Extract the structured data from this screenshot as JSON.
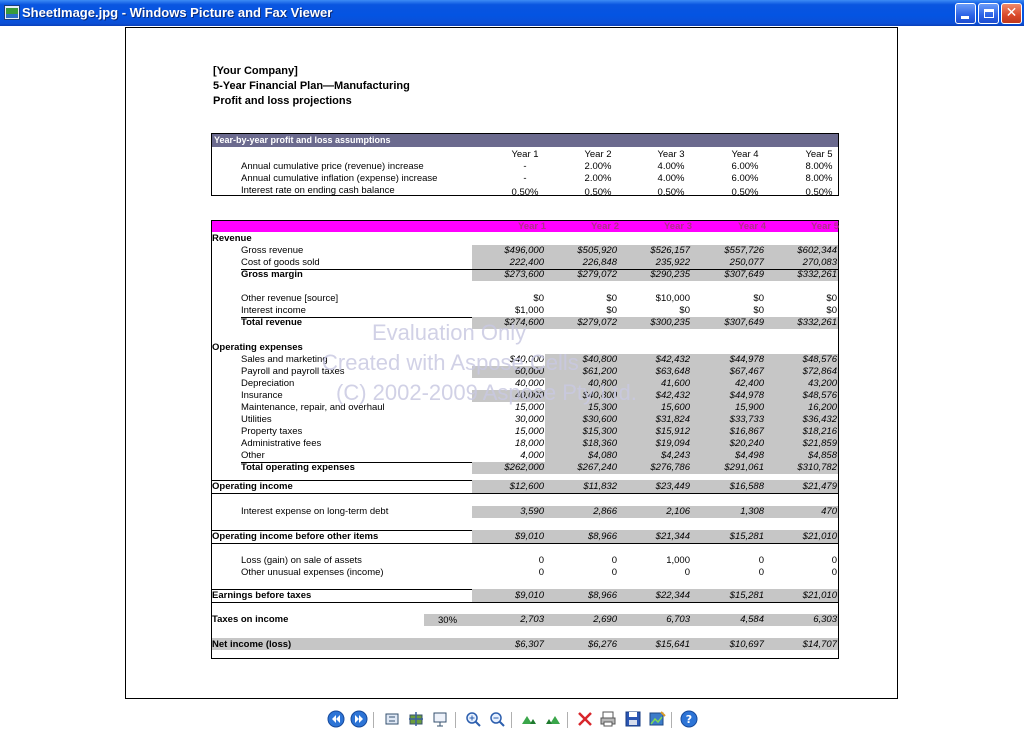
{
  "window": {
    "title": "SheetImage.jpg - Windows Picture and Fax Viewer"
  },
  "header": {
    "company": "[Your Company]",
    "plan": "5-Year Financial Plan—Manufacturing",
    "subtitle": "Profit and loss projections"
  },
  "assumptions": {
    "title": "Year-by-year profit and loss assumptions",
    "years": [
      "Year 1",
      "Year 2",
      "Year 3",
      "Year 4",
      "Year 5"
    ],
    "rows": [
      {
        "label": "Annual cumulative price (revenue) increase",
        "values": [
          "-",
          "2.00%",
          "4.00%",
          "6.00%",
          "8.00%"
        ]
      },
      {
        "label": "Annual cumulative inflation (expense) increase",
        "values": [
          "-",
          "2.00%",
          "4.00%",
          "6.00%",
          "8.00%"
        ]
      },
      {
        "label": "Interest rate on ending cash balance",
        "values": [
          "0.50%",
          "0.50%",
          "0.50%",
          "0.50%",
          "0.50%"
        ]
      }
    ]
  },
  "main": {
    "years": [
      "Year 1",
      "Year 2",
      "Year 3",
      "Year 4",
      "Year 5"
    ],
    "revenue": {
      "heading": "Revenue",
      "gross_revenue": {
        "label": "Gross revenue",
        "values": [
          "$496,000",
          "$505,920",
          "$526,157",
          "$557,726",
          "$602,344"
        ]
      },
      "cogs": {
        "label": "Cost of goods sold",
        "values": [
          "222,400",
          "226,848",
          "235,922",
          "250,077",
          "270,083"
        ]
      },
      "gross_margin": {
        "label": "Gross margin",
        "values": [
          "$273,600",
          "$279,072",
          "$290,235",
          "$307,649",
          "$332,261"
        ]
      },
      "other_revenue": {
        "label": "Other revenue [source]",
        "values": [
          "$0",
          "$0",
          "$10,000",
          "$0",
          "$0"
        ]
      },
      "interest_income": {
        "label": "Interest income",
        "values": [
          "$1,000",
          "$0",
          "$0",
          "$0",
          "$0"
        ]
      },
      "total_revenue": {
        "label": "Total revenue",
        "values": [
          "$274,600",
          "$279,072",
          "$300,235",
          "$307,649",
          "$332,261"
        ]
      }
    },
    "opex": {
      "heading": "Operating expenses",
      "rows": [
        {
          "label": "Sales and marketing",
          "values": [
            "$40,000",
            "$40,800",
            "$42,432",
            "$44,978",
            "$48,576"
          ]
        },
        {
          "label": "Payroll and payroll taxes",
          "values": [
            "60,000",
            "$61,200",
            "$63,648",
            "$67,467",
            "$72,864"
          ]
        },
        {
          "label": "Depreciation",
          "values": [
            "40,000",
            "40,800",
            "41,600",
            "42,400",
            "43,200"
          ]
        },
        {
          "label": "Insurance",
          "values": [
            "40,000",
            "$40,800",
            "$42,432",
            "$44,978",
            "$48,576"
          ]
        },
        {
          "label": "Maintenance, repair, and overhaul",
          "values": [
            "15,000",
            "15,300",
            "15,600",
            "15,900",
            "16,200"
          ]
        },
        {
          "label": "Utilities",
          "values": [
            "30,000",
            "$30,600",
            "$31,824",
            "$33,733",
            "$36,432"
          ]
        },
        {
          "label": "Property taxes",
          "values": [
            "15,000",
            "$15,300",
            "$15,912",
            "$16,867",
            "$18,216"
          ]
        },
        {
          "label": "Administrative fees",
          "values": [
            "18,000",
            "$18,360",
            "$19,094",
            "$20,240",
            "$21,859"
          ]
        },
        {
          "label": "Other",
          "values": [
            "4,000",
            "$4,080",
            "$4,243",
            "$4,498",
            "$4,858"
          ]
        }
      ],
      "total": {
        "label": "Total operating expenses",
        "values": [
          "$262,000",
          "$267,240",
          "$276,786",
          "$291,061",
          "$310,782"
        ]
      }
    },
    "operating_income": {
      "label": "Operating income",
      "values": [
        "$12,600",
        "$11,832",
        "$23,449",
        "$16,588",
        "$21,479"
      ]
    },
    "interest_expense": {
      "label": "Interest expense on long-term debt",
      "values": [
        "3,590",
        "2,866",
        "2,106",
        "1,308",
        "470"
      ]
    },
    "oi_before_other": {
      "label": "Operating income before other items",
      "values": [
        "$9,010",
        "$8,966",
        "$21,344",
        "$15,281",
        "$21,010"
      ]
    },
    "loss_gain": {
      "label": "Loss (gain) on sale of assets",
      "values": [
        "0",
        "0",
        "1,000",
        "0",
        "0"
      ]
    },
    "other_unusual": {
      "label": "Other unusual expenses (income)",
      "values": [
        "0",
        "0",
        "0",
        "0",
        "0"
      ]
    },
    "ebt": {
      "label": "Earnings before taxes",
      "values": [
        "$9,010",
        "$8,966",
        "$22,344",
        "$15,281",
        "$21,010"
      ]
    },
    "taxes": {
      "label": "Taxes on income",
      "rate": "30%",
      "values": [
        "2,703",
        "2,690",
        "6,703",
        "4,584",
        "6,303"
      ]
    },
    "net_income": {
      "label": "Net income (loss)",
      "values": [
        "$6,307",
        "$6,276",
        "$15,641",
        "$10,697",
        "$14,707"
      ]
    }
  },
  "watermark": {
    "line1": "Evaluation Only",
    "line2": "Created with Aspose.Cells",
    "line3": "(C) 2002-2009 Aspose Pty Ltd."
  },
  "toolbar": {
    "icons": [
      "previous-image-icon",
      "next-image-icon",
      "best-fit-icon",
      "actual-size-icon",
      "slideshow-icon",
      "zoom-in-icon",
      "zoom-out-icon",
      "rotate-clockwise-icon",
      "rotate-counterclockwise-icon",
      "delete-icon",
      "print-icon",
      "save-icon",
      "open-editor-icon",
      "help-icon"
    ]
  },
  "colors": {
    "titlebar": "#0454e2",
    "assumptions_bar": "#6b6a8e",
    "year_bar": "#ff00ff",
    "shade": "#c6c6c6",
    "watermark": "#c9c9e2"
  }
}
